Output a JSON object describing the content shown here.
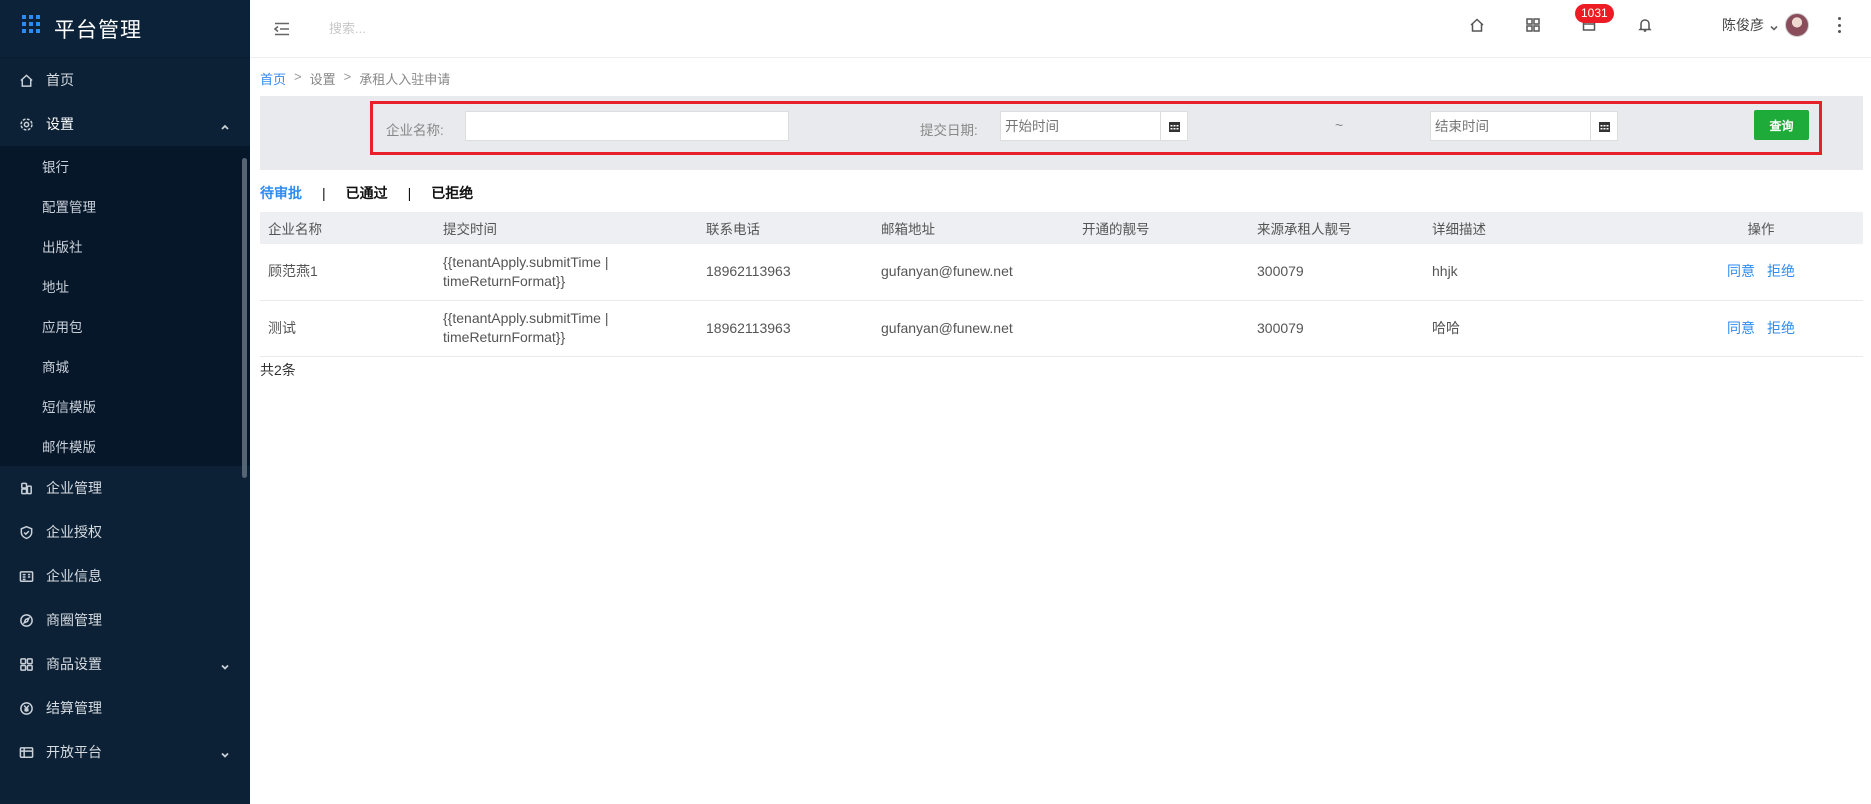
{
  "app": {
    "title": "平台管理"
  },
  "sidebar": {
    "items": [
      {
        "label": "首页",
        "icon": "home-icon"
      },
      {
        "label": "设置",
        "icon": "gear-icon",
        "expanded": true,
        "children": [
          "银行",
          "配置管理",
          "出版社",
          "地址",
          "应用包",
          "商城",
          "短信模版",
          "邮件模版"
        ]
      },
      {
        "label": "企业管理",
        "icon": "enterprise-icon"
      },
      {
        "label": "企业授权",
        "icon": "shield-icon"
      },
      {
        "label": "企业信息",
        "icon": "id-card-icon"
      },
      {
        "label": "商圈管理",
        "icon": "compass-icon"
      },
      {
        "label": "商品设置",
        "icon": "apps-icon",
        "has_children": true
      },
      {
        "label": "结算管理",
        "icon": "yen-icon"
      },
      {
        "label": "开放平台",
        "icon": "table-icon",
        "has_children": true
      }
    ]
  },
  "topbar": {
    "search_placeholder": "搜索...",
    "notification_count": "1031",
    "user_name": "陈俊彦"
  },
  "breadcrumb": [
    "首页",
    "设置",
    "承租人入驻申请"
  ],
  "filter": {
    "company_label": "企业名称:",
    "company_value": "",
    "date_label": "提交日期:",
    "start_placeholder": "开始时间",
    "tilde": "~",
    "end_placeholder": "结束时间",
    "query_label": "查询"
  },
  "tabs": [
    {
      "label": "待审批",
      "active": true
    },
    {
      "label": "已通过",
      "active": false
    },
    {
      "label": "已拒绝",
      "active": false
    }
  ],
  "table": {
    "headers": [
      "企业名称",
      "提交时间",
      "联系电话",
      "邮箱地址",
      "开通的靓号",
      "来源承租人靓号",
      "详细描述",
      "操作"
    ],
    "rows": [
      {
        "company": "顾范燕1",
        "submit_time": "{{tenantApply.submitTime | timeReturnFormat}}",
        "phone": "18962113963",
        "email": "gufanyan@funew.net",
        "number": "",
        "source": "300079",
        "desc": "hhjk",
        "agree": "同意",
        "reject": "拒绝"
      },
      {
        "company": "测试",
        "submit_time": "{{tenantApply.submitTime | timeReturnFormat}}",
        "phone": "18962113963",
        "email": "gufanyan@funew.net",
        "number": "",
        "source": "300079",
        "desc": "哈哈",
        "agree": "同意",
        "reject": "拒绝"
      }
    ]
  },
  "total": "共2条",
  "colors": {
    "sidebar_bg": "#0c2135",
    "accent": "#2d8cf0",
    "query_button": "#1fab39",
    "highlight_border": "#e8202a",
    "badge": "#ed1c24"
  }
}
